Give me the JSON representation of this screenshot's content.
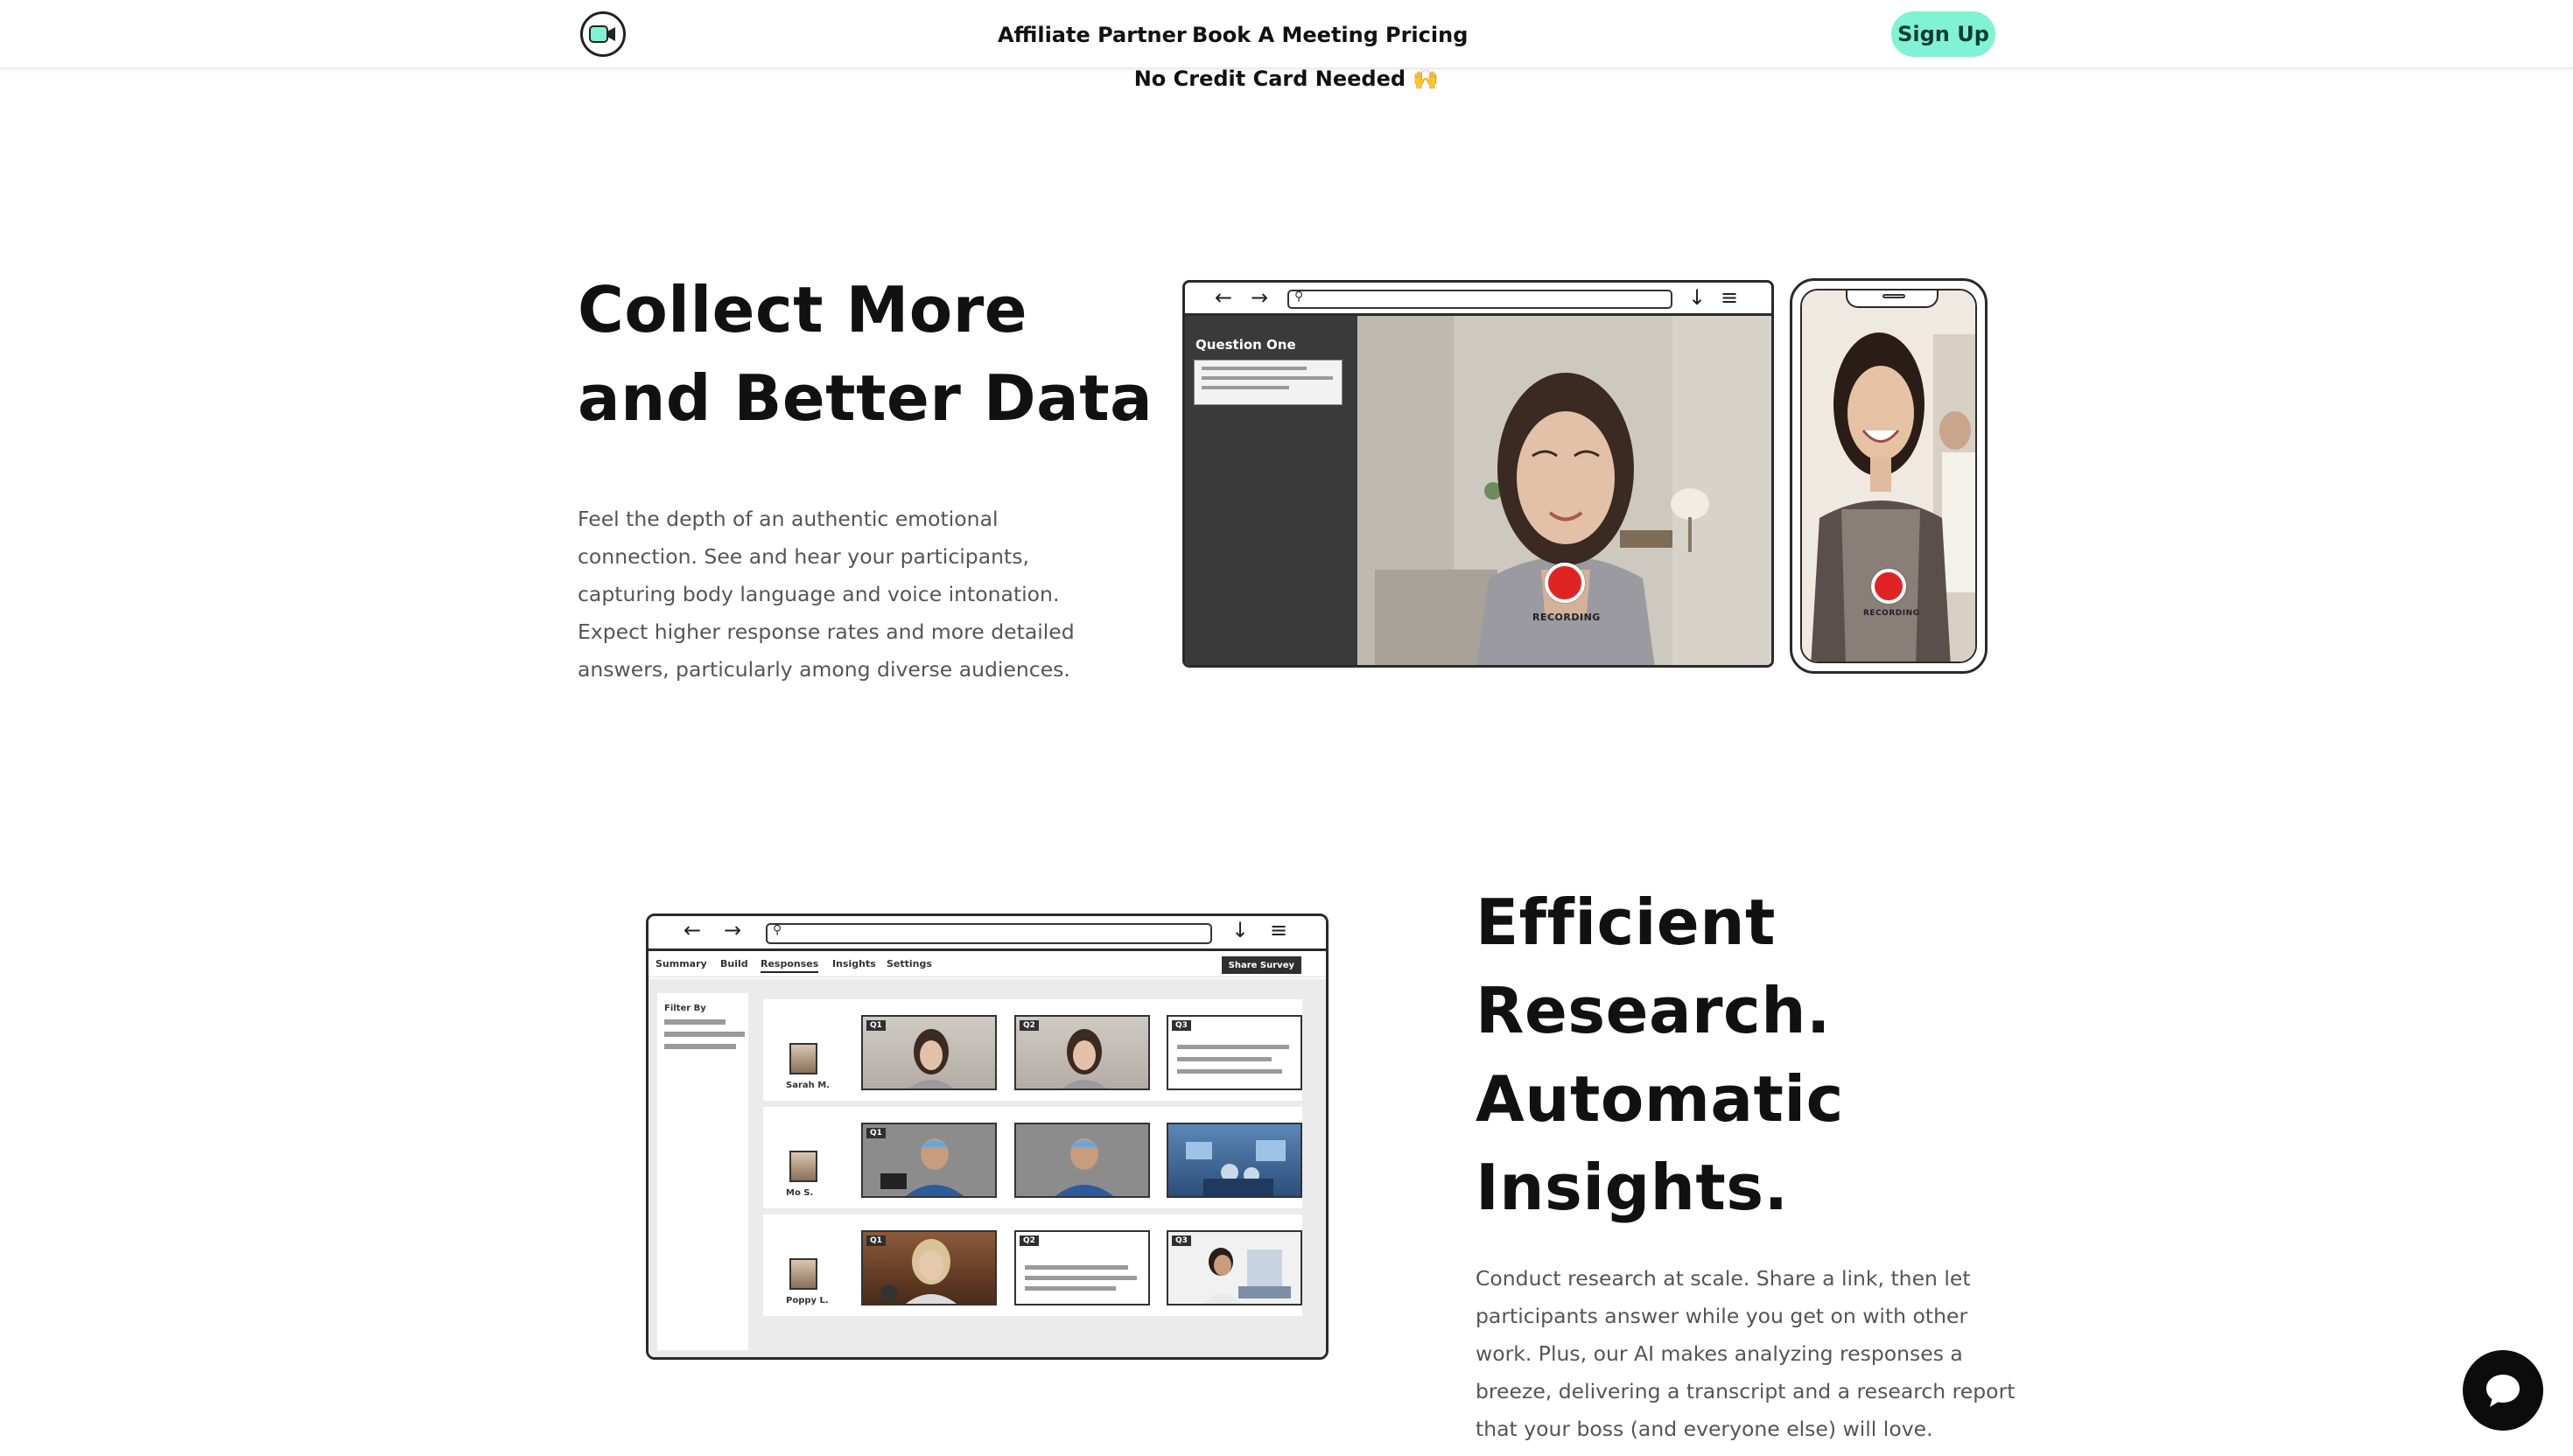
{
  "header": {
    "logo_icon": "video-camera-logo-icon",
    "nav": [
      "Affiliate Partner",
      "Book A Meeting",
      "Pricing"
    ],
    "signup_label": "Sign Up",
    "accent_color": "#7ff3d3"
  },
  "banner": {
    "no_card_text": "No Credit Card Needed 🙌"
  },
  "section_collect": {
    "title_line1": "Collect More",
    "title_line2": "and Better Data",
    "body": "Feel the depth of an authentic emotional connection. See and hear your participants, capturing body language and voice intonation. Expect higher response rates and more detailed answers, particularly among diverse audiences.",
    "mock": {
      "question_title": "Question One",
      "recording_label": "RECORDING",
      "record_color": "#e02424"
    }
  },
  "section_research": {
    "title_lines": [
      "Efficient",
      "Research.",
      "Automatic",
      "Insights."
    ],
    "body": "Conduct research at scale. Share a link, then let participants answer while you get on with other work. Plus, our AI makes analyzing responses a breeze, delivering a transcript and a research report that your boss (and everyone else) will love.",
    "mock": {
      "tabs": [
        "Summary",
        "Build",
        "Responses",
        "Insights",
        "Settings"
      ],
      "active_tab": "Responses",
      "share_label": "Share Survey",
      "filter_title": "Filter By",
      "participants": [
        {
          "name": "Sarah M.",
          "labels": [
            "Q1",
            "Q2",
            "Q3"
          ]
        },
        {
          "name": "Mo S.",
          "labels": [
            "Q1"
          ]
        },
        {
          "name": "Poppy L.",
          "labels": [
            "Q1",
            "Q2",
            "Q3"
          ]
        }
      ]
    }
  },
  "chat_widget": {
    "icon": "chat-bubble-icon"
  }
}
